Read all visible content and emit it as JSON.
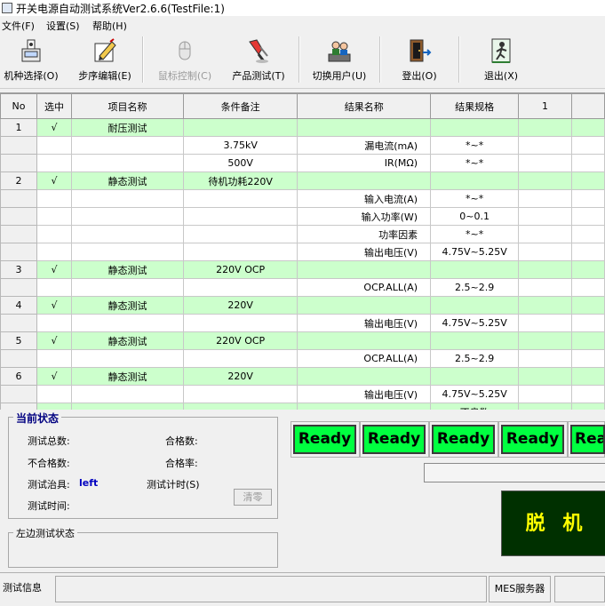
{
  "window": {
    "title": "开关电源自动测试系统Ver2.6.6(TestFile:1)"
  },
  "menu": {
    "items": [
      "文件(F)",
      "设置(S)",
      "帮助(H)"
    ]
  },
  "toolbar": {
    "buttons": [
      {
        "label": "机种选择(O)",
        "icon": "machine-icon",
        "enabled": true
      },
      {
        "label": "步序编辑(E)",
        "icon": "edit-icon",
        "enabled": true
      },
      {
        "label": "鼠标控制(C)",
        "icon": "mouse-icon",
        "enabled": false
      },
      {
        "label": "产品测试(T)",
        "icon": "test-icon",
        "enabled": true
      },
      {
        "label": "切换用户(U)",
        "icon": "users-icon",
        "enabled": true
      },
      {
        "label": "登出(O)",
        "icon": "logout-door-icon",
        "enabled": true
      },
      {
        "label": "退出(X)",
        "icon": "exit-icon",
        "enabled": true
      }
    ]
  },
  "grid": {
    "headers": [
      "No",
      "选中",
      "项目名称",
      "条件备注",
      "结果名称",
      "结果规格",
      "1",
      ""
    ],
    "rows": [
      {
        "group": true,
        "cells": [
          "1",
          "√",
          "耐压测试",
          "",
          "",
          "",
          "",
          ""
        ]
      },
      {
        "group": false,
        "cells": [
          "",
          "",
          "",
          "3.75kV",
          "漏电流(mA)",
          "*~*",
          "",
          ""
        ]
      },
      {
        "group": false,
        "cells": [
          "",
          "",
          "",
          "500V",
          "IR(MΩ)",
          "*~*",
          "",
          ""
        ]
      },
      {
        "group": true,
        "cells": [
          "2",
          "√",
          "静态测试",
          "待机功耗220V",
          "",
          "",
          "",
          ""
        ]
      },
      {
        "group": false,
        "cells": [
          "",
          "",
          "",
          "",
          "输入电流(A)",
          "*~*",
          "",
          ""
        ]
      },
      {
        "group": false,
        "cells": [
          "",
          "",
          "",
          "",
          "输入功率(W)",
          "0~0.1",
          "",
          ""
        ]
      },
      {
        "group": false,
        "cells": [
          "",
          "",
          "",
          "",
          "功率因素",
          "*~*",
          "",
          ""
        ]
      },
      {
        "group": false,
        "cells": [
          "",
          "",
          "",
          "",
          "输出电压(V)",
          "4.75V~5.25V",
          "",
          ""
        ]
      },
      {
        "group": true,
        "cells": [
          "3",
          "√",
          "静态测试",
          "220V  OCP",
          "",
          "",
          "",
          ""
        ]
      },
      {
        "group": false,
        "cells": [
          "",
          "",
          "",
          "",
          "OCP.ALL(A)",
          "2.5~2.9",
          "",
          ""
        ]
      },
      {
        "group": true,
        "cells": [
          "4",
          "√",
          "静态测试",
          "220V",
          "",
          "",
          "",
          ""
        ]
      },
      {
        "group": false,
        "cells": [
          "",
          "",
          "",
          "",
          "输出电压(V)",
          "4.75V~5.25V",
          "",
          ""
        ]
      },
      {
        "group": true,
        "cells": [
          "5",
          "√",
          "静态测试",
          "220V  OCP",
          "",
          "",
          "",
          ""
        ]
      },
      {
        "group": false,
        "cells": [
          "",
          "",
          "",
          "",
          "OCP.ALL(A)",
          "2.5~2.9",
          "",
          ""
        ]
      },
      {
        "group": true,
        "cells": [
          "6",
          "√",
          "静态测试",
          "220V",
          "",
          "",
          "",
          ""
        ]
      },
      {
        "group": false,
        "cells": [
          "",
          "",
          "",
          "",
          "输出电压(V)",
          "4.75V~5.25V",
          "",
          ""
        ]
      },
      {
        "group": true,
        "cells": [
          "",
          "",
          "",
          "",
          "",
          "不良数",
          "",
          ""
        ]
      }
    ]
  },
  "status": {
    "title": "当前状态",
    "total_label": "测试总数:",
    "pass_label": "合格数:",
    "fail_label": "不合格数:",
    "pass_rate_label": "合格率:",
    "fixture_label": "测试治具:",
    "fixture_value": "left",
    "timer_label": "测试计时(S)",
    "time_label": "测试时间:",
    "clear_label": "清零"
  },
  "left_status": {
    "title": "左边测试状态"
  },
  "ready": {
    "labels": [
      "Ready",
      "Ready",
      "Ready",
      "Ready",
      "Ready"
    ],
    "color": "#00ff40"
  },
  "offline": {
    "label": "脱 机",
    "bg": "#003000",
    "color": "#ffff00"
  },
  "statusbar": {
    "info_label": "测试信息",
    "mes_label": "MES服务器"
  }
}
